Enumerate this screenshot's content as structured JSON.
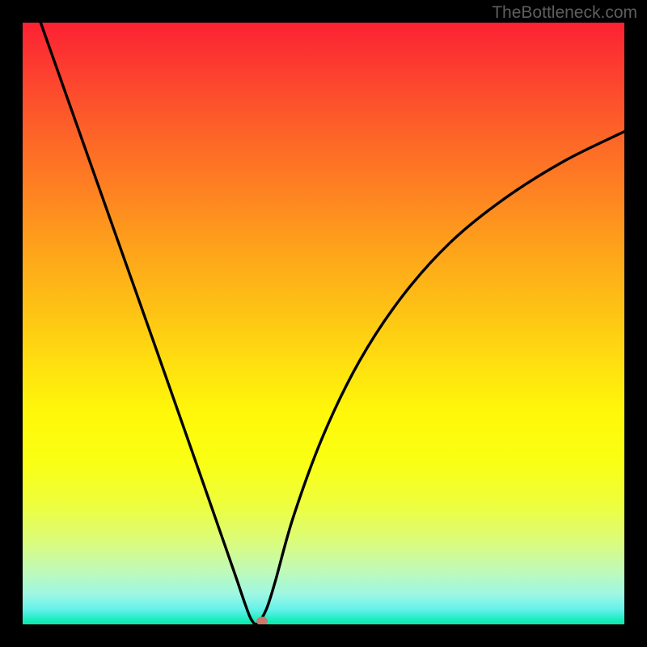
{
  "watermark": "TheBottleneck.com",
  "colors": {
    "background": "#000000",
    "curve_stroke": "#000000",
    "marker_fill": "#c97a6d",
    "watermark_text": "#5e5e5e"
  },
  "chart_data": {
    "type": "line",
    "title": "",
    "xlabel": "",
    "ylabel": "",
    "xlim": [
      0,
      100
    ],
    "ylim": [
      0,
      100
    ],
    "description": "Bottleneck V-curve: decreasing left branch to a sharp minimum, then increasing right branch that decelerates. Background is a vertical rainbow gradient red→yellow→green. Sharp dip near x≈39 touching y≈0.",
    "series": [
      {
        "name": "bottleneck-curve",
        "x": [
          3,
          6,
          10,
          14,
          18,
          22,
          26,
          30,
          33,
          35.5,
          37,
          38,
          39,
          40.5,
          42,
          45,
          50,
          56,
          63,
          71,
          80,
          90,
          100
        ],
        "y": [
          100,
          91.5,
          80.2,
          68.9,
          57.6,
          46.3,
          34.9,
          23.5,
          14.9,
          7.7,
          3.3,
          0.8,
          0.1,
          2.5,
          7.2,
          17.9,
          31.5,
          43.8,
          54.4,
          63.4,
          70.7,
          77.0,
          81.9
        ]
      }
    ],
    "marker": {
      "x": 39.8,
      "y": 0.5
    },
    "gradient_stops": [
      {
        "pct": 0,
        "color": "#fc2133"
      },
      {
        "pct": 28,
        "color": "#fe8222"
      },
      {
        "pct": 56,
        "color": "#ffdd10"
      },
      {
        "pct": 80,
        "color": "#eefe3d"
      },
      {
        "pct": 95,
        "color": "#9ef7e4"
      },
      {
        "pct": 100,
        "color": "#07eba8"
      }
    ]
  }
}
